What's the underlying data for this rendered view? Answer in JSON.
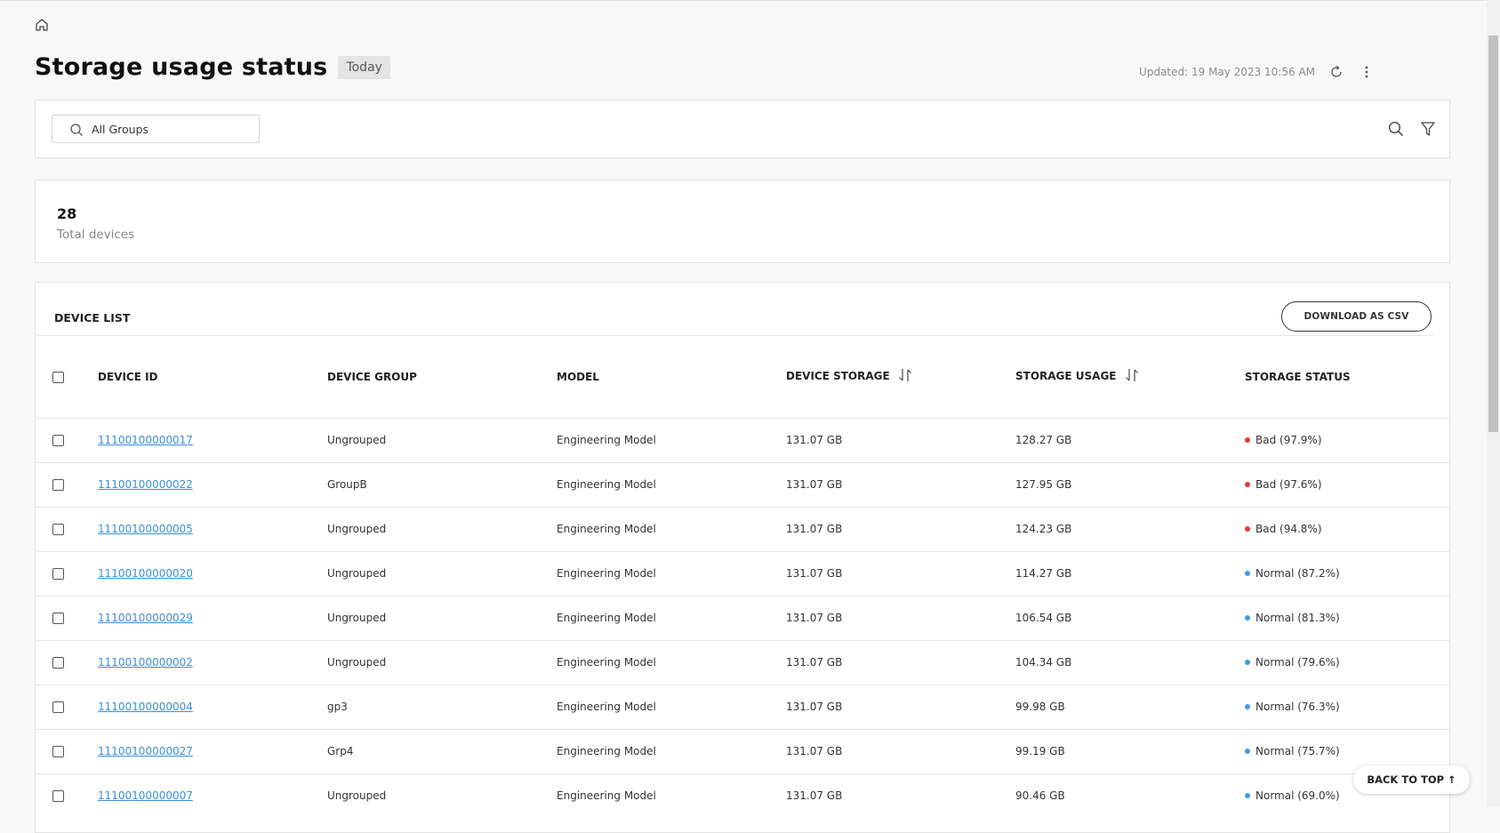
{
  "header": {
    "title": "Storage usage status",
    "badge": "Today",
    "updated": "Updated: 19 May 2023 10:56 AM"
  },
  "search": {
    "placeholder": "All Groups"
  },
  "summary": {
    "count": "28",
    "label": "Total devices"
  },
  "device_list": {
    "title": "DEVICE LIST",
    "download_label": "DOWNLOAD AS CSV",
    "columns": [
      "DEVICE ID",
      "DEVICE GROUP",
      "MODEL",
      "DEVICE STORAGE",
      "STORAGE USAGE",
      "STORAGE STATUS"
    ],
    "rows": [
      {
        "id": "11100100000017",
        "group": "Ungrouped",
        "model": "Engineering Model",
        "storage": "131.07 GB",
        "usage": "128.27 GB",
        "status": "Bad (97.9%)",
        "level": "bad"
      },
      {
        "id": "11100100000022",
        "group": "GroupB",
        "model": "Engineering Model",
        "storage": "131.07 GB",
        "usage": "127.95 GB",
        "status": "Bad (97.6%)",
        "level": "bad"
      },
      {
        "id": "11100100000005",
        "group": "Ungrouped",
        "model": "Engineering Model",
        "storage": "131.07 GB",
        "usage": "124.23 GB",
        "status": "Bad (94.8%)",
        "level": "bad"
      },
      {
        "id": "11100100000020",
        "group": "Ungrouped",
        "model": "Engineering Model",
        "storage": "131.07 GB",
        "usage": "114.27 GB",
        "status": "Normal (87.2%)",
        "level": "normal"
      },
      {
        "id": "11100100000029",
        "group": "Ungrouped",
        "model": "Engineering Model",
        "storage": "131.07 GB",
        "usage": "106.54 GB",
        "status": "Normal (81.3%)",
        "level": "normal"
      },
      {
        "id": "11100100000002",
        "group": "Ungrouped",
        "model": "Engineering Model",
        "storage": "131.07 GB",
        "usage": "104.34 GB",
        "status": "Normal (79.6%)",
        "level": "normal"
      },
      {
        "id": "11100100000004",
        "group": "gp3",
        "model": "Engineering Model",
        "storage": "131.07 GB",
        "usage": "99.98 GB",
        "status": "Normal (76.3%)",
        "level": "normal"
      },
      {
        "id": "11100100000027",
        "group": "Grp4",
        "model": "Engineering Model",
        "storage": "131.07 GB",
        "usage": "99.19 GB",
        "status": "Normal (75.7%)",
        "level": "normal"
      },
      {
        "id": "11100100000007",
        "group": "Ungrouped",
        "model": "Engineering Model",
        "storage": "131.07 GB",
        "usage": "90.46 GB",
        "status": "Normal (69.0%)",
        "level": "normal"
      }
    ]
  },
  "back_to_top": "BACK TO TOP ↑",
  "colors": {
    "bad": "#e53935",
    "normal": "#3d9be9",
    "link": "#3a8fd8"
  },
  "icons": [
    "home-icon",
    "refresh-icon",
    "more-vertical-icon",
    "search-icon",
    "filter-icon",
    "sort-icon"
  ]
}
